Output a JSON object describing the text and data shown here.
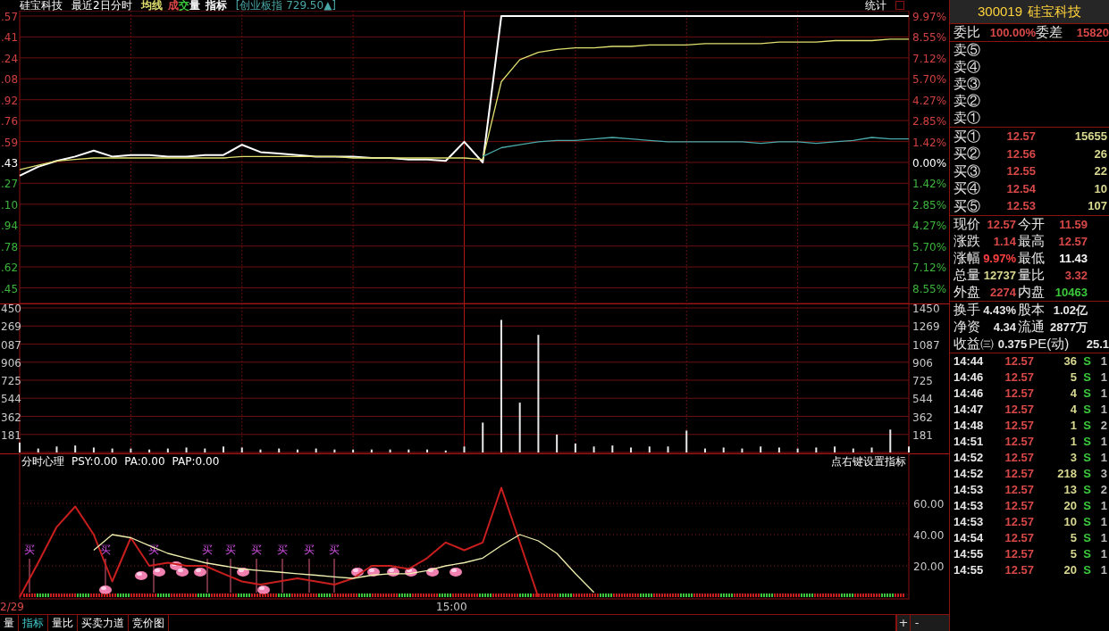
{
  "title_bar": {
    "stock_name": "硅宝科技",
    "period": "最近2日分时",
    "legend": [
      {
        "label": "均线",
        "color": "#e0e070"
      },
      {
        "label": "成",
        "color": "#e04848"
      },
      {
        "label": "交",
        "color": "#3cc83c"
      },
      {
        "label": "量",
        "color": "#ffffff"
      },
      {
        "label": "指标",
        "color": "#ffffff"
      }
    ],
    "index_info": "[创业板指 729.50▲]",
    "stats_button": "统计"
  },
  "price_chart": {
    "left_axis_labels": [
      ".57",
      ".41",
      ".24",
      ".08",
      ".92",
      ".76",
      ".59",
      ".43",
      ".27",
      ".10",
      ".94",
      ".78",
      ".62",
      ".45"
    ],
    "chart_data": {
      "type": "line",
      "categories": [
        null,
        null,
        null,
        null,
        null,
        null,
        null,
        null,
        null,
        null,
        null,
        null,
        null,
        null,
        null,
        null,
        null,
        null,
        null,
        null,
        null,
        null,
        null,
        null,
        null,
        null,
        null,
        null,
        null,
        null,
        null,
        null,
        null,
        null,
        null,
        null,
        null,
        null,
        null,
        null,
        null,
        null,
        null,
        null,
        null,
        null,
        null,
        null,
        null
      ],
      "ylim": [
        -9.61,
        9.97
      ],
      "grid": true,
      "yticks": [
        {
          "value": 9.97,
          "label": "9.97%"
        },
        {
          "value": 8.55,
          "label": "8.55%"
        },
        {
          "value": 7.12,
          "label": "7.12%"
        },
        {
          "value": 5.7,
          "label": "5.70%"
        },
        {
          "value": 4.27,
          "label": "4.27%"
        },
        {
          "value": 2.85,
          "label": "2.85%"
        },
        {
          "value": 1.42,
          "label": "1.42%"
        },
        {
          "value": 0,
          "label": "0.00%"
        },
        {
          "value": -1.42,
          "label": "1.42%"
        },
        {
          "value": -2.85,
          "label": "2.85%"
        },
        {
          "value": -4.27,
          "label": "4.27%"
        },
        {
          "value": -5.7,
          "label": "5.70%"
        },
        {
          "value": -7.12,
          "label": "7.12%"
        },
        {
          "value": -8.55,
          "label": "8.55%"
        }
      ],
      "series": [
        {
          "color": "#ffffff",
          "values": [
            -0.9,
            -0.3,
            0.1,
            0.4,
            0.8,
            0.4,
            0.5,
            0.5,
            0.4,
            0.4,
            0.5,
            0.5,
            1.2,
            0.7,
            0.6,
            0.5,
            0.4,
            0.4,
            0.4,
            0.3,
            0.3,
            0.2,
            0.2,
            0.1,
            1.4,
            0.0,
            9.97,
            9.97,
            9.97,
            9.97,
            9.97,
            9.97,
            9.97,
            9.97,
            9.97,
            9.97,
            9.97,
            9.97,
            9.97,
            9.97,
            9.97,
            9.97,
            9.97,
            9.97,
            9.97,
            9.97,
            9.97,
            9.97,
            9.97
          ]
        },
        {
          "color": "#e0e070",
          "values": [
            -0.5,
            -0.2,
            0.1,
            0.2,
            0.3,
            0.3,
            0.3,
            0.3,
            0.3,
            0.3,
            0.3,
            0.3,
            0.4,
            0.4,
            0.4,
            0.4,
            0.4,
            0.4,
            0.3,
            0.3,
            0.3,
            0.3,
            0.3,
            0.3,
            0.3,
            0.2,
            5.5,
            7.0,
            7.5,
            7.7,
            7.8,
            7.8,
            7.9,
            7.9,
            8.0,
            8.0,
            8.0,
            8.1,
            8.1,
            8.1,
            8.1,
            8.2,
            8.2,
            8.2,
            8.3,
            8.3,
            8.3,
            8.4,
            8.4
          ]
        },
        {
          "color": "#4aa8a8",
          "values": [
            null,
            null,
            null,
            null,
            null,
            null,
            null,
            null,
            null,
            null,
            null,
            null,
            null,
            null,
            null,
            null,
            null,
            null,
            null,
            null,
            null,
            null,
            null,
            null,
            null,
            0.4,
            1.0,
            1.2,
            1.4,
            1.5,
            1.5,
            1.6,
            1.7,
            1.6,
            1.5,
            1.4,
            1.4,
            1.4,
            1.4,
            1.4,
            1.3,
            1.4,
            1.4,
            1.3,
            1.4,
            1.5,
            1.7,
            1.6,
            1.6
          ]
        }
      ]
    }
  },
  "volume_chart": {
    "left_axis_labels": [
      "450",
      "269",
      "087",
      "906",
      "725",
      "544",
      "362",
      "181"
    ],
    "chart_data": {
      "type": "bar",
      "categories": [
        null,
        null,
        null,
        null,
        null,
        null,
        null,
        null,
        null,
        null,
        null,
        null,
        null,
        null,
        null,
        null,
        null,
        null,
        null,
        null,
        null,
        null,
        null,
        null,
        null,
        null,
        null,
        null,
        null,
        null,
        null,
        null,
        null,
        null,
        null,
        null,
        null,
        null,
        null,
        null,
        null,
        null,
        null,
        null,
        null,
        null,
        null,
        null,
        null
      ],
      "ylim": [
        0,
        1495
      ],
      "grid": true,
      "yticks": [
        {
          "value": 1450,
          "label": "1450"
        },
        {
          "value": 1269,
          "label": "1269"
        },
        {
          "value": 1087,
          "label": "1087"
        },
        {
          "value": 906,
          "label": "906"
        },
        {
          "value": 725,
          "label": "725"
        },
        {
          "value": 544,
          "label": "544"
        },
        {
          "value": 362,
          "label": "362"
        },
        {
          "value": 181,
          "label": "181"
        }
      ],
      "series": [
        {
          "color": "#e8e8e8",
          "values": [
            100,
            40,
            60,
            70,
            50,
            40,
            40,
            30,
            40,
            50,
            40,
            60,
            50,
            30,
            40,
            30,
            40,
            30,
            30,
            30,
            30,
            30,
            30,
            20,
            60,
            300,
            1330,
            500,
            1180,
            180,
            90,
            60,
            70,
            50,
            60,
            60,
            220,
            40,
            50,
            40,
            60,
            50,
            40,
            50,
            60,
            40,
            50,
            230,
            60
          ]
        }
      ]
    }
  },
  "indicator": {
    "name": "分时心理",
    "readings": [
      "PSY:0.00",
      "PA:0.00",
      "PAP:0.00"
    ],
    "hint": "点右键设置指标",
    "chart_data": {
      "type": "line",
      "categories": [
        null,
        null,
        null,
        null,
        null,
        null,
        null,
        null,
        null,
        null,
        null,
        null,
        null,
        null,
        null,
        null,
        null,
        null,
        null,
        null,
        null,
        null,
        null,
        null,
        null,
        null,
        null,
        null,
        null,
        null,
        null,
        null,
        null,
        null,
        null,
        null,
        null,
        null,
        null,
        null,
        null,
        null,
        null,
        null,
        null,
        null,
        null,
        null,
        null
      ],
      "ylim": [
        0,
        92
      ],
      "grid": true,
      "yticks": [
        {
          "value": 60,
          "label": "60.00"
        },
        {
          "value": 40,
          "label": "40.00"
        },
        {
          "value": 20,
          "label": "20.00"
        }
      ],
      "series": [
        {
          "color": "#c81e1e",
          "values": [
            0,
            22,
            45,
            58,
            40,
            10,
            38,
            20,
            22,
            20,
            20,
            15,
            10,
            8,
            10,
            12,
            10,
            8,
            12,
            20,
            20,
            18,
            25,
            35,
            30,
            35,
            70,
            35,
            0,
            null,
            null,
            null,
            null,
            null,
            null,
            null,
            null,
            null,
            null,
            null,
            null,
            null,
            null,
            null,
            null,
            null,
            null,
            null,
            null
          ]
        },
        {
          "color": "#f0f0b0",
          "values": [
            null,
            null,
            null,
            null,
            30,
            40,
            38,
            33,
            28,
            25,
            22,
            20,
            18,
            17,
            16,
            15,
            14,
            13,
            12,
            14,
            15,
            15,
            17,
            20,
            22,
            25,
            33,
            40,
            36,
            28,
            15,
            3,
            null,
            null,
            null,
            null,
            null,
            null,
            null,
            null,
            null,
            null,
            null,
            null,
            null,
            null,
            null,
            null,
            null
          ]
        }
      ]
    },
    "buy_marks": [
      "买",
      "买",
      "买",
      "买",
      "买",
      "买",
      "买",
      "买",
      "买"
    ]
  },
  "x_axis": {
    "date_label": "2/29",
    "time_label": "15:00"
  },
  "tabs": [
    {
      "label": "量",
      "selected": false
    },
    {
      "label": "指标",
      "selected": true
    },
    {
      "label": "量比",
      "selected": false
    },
    {
      "label": "买卖力道",
      "selected": false
    },
    {
      "label": "竞价图",
      "selected": false
    }
  ],
  "zoom_buttons": [
    "+",
    "-"
  ],
  "quote_panel": {
    "code": "300019",
    "name": "硅宝科技",
    "order_ratio": [
      {
        "label": "委比",
        "value": "100.00%"
      },
      {
        "label": "委差",
        "value": "15820"
      }
    ],
    "sell_levels": [
      {
        "label": "卖⑤"
      },
      {
        "label": "卖④"
      },
      {
        "label": "卖③"
      },
      {
        "label": "卖②"
      },
      {
        "label": "卖①"
      }
    ],
    "buy_levels": [
      {
        "label": "买①",
        "price": "12.57",
        "volume": "15655"
      },
      {
        "label": "买②",
        "price": "12.56",
        "volume": "26"
      },
      {
        "label": "买③",
        "price": "12.55",
        "volume": "22"
      },
      {
        "label": "买④",
        "price": "12.54",
        "volume": "10"
      },
      {
        "label": "买⑤",
        "price": "12.53",
        "volume": "107"
      }
    ],
    "quote_rows": [
      [
        {
          "label": "现价",
          "value": "12.57",
          "color": "#d84848"
        },
        {
          "label": "今开",
          "value": "11.59",
          "color": "#d84848"
        }
      ],
      [
        {
          "label": "涨跌",
          "value": "1.14",
          "color": "#d84848"
        },
        {
          "label": "最高",
          "value": "12.57",
          "color": "#d84848"
        }
      ],
      [
        {
          "label": "涨幅",
          "value": "9.97%",
          "color": "#ff4040"
        },
        {
          "label": "最低",
          "value": "11.43",
          "color": "#ffffff"
        }
      ],
      [
        {
          "label": "总量",
          "value": "12737",
          "color": "#d8d890"
        },
        {
          "label": "量比",
          "value": "3.32",
          "color": "#d84848"
        }
      ],
      [
        {
          "label": "外盘",
          "value": "2274",
          "color": "#d84848"
        },
        {
          "label": "内盘",
          "value": "10463",
          "color": "#3cc83c"
        }
      ]
    ],
    "stats_rows": [
      [
        {
          "label": "换手",
          "value": "4.43%"
        },
        {
          "label": "股本",
          "value": "1.02亿"
        }
      ],
      [
        {
          "label": "净资",
          "value": "4.34"
        },
        {
          "label": "流通",
          "value": "2877万"
        }
      ],
      [
        {
          "label": "收益㈢",
          "value": "0.375"
        },
        {
          "label": "PE(动)",
          "value": "25.1"
        }
      ]
    ],
    "trades": [
      {
        "time": "14:44",
        "price": "12.57",
        "volume": "36",
        "side": "S",
        "column_5": "1"
      },
      {
        "time": "14:46",
        "price": "12.57",
        "volume": "5",
        "side": "S",
        "column_5": "1"
      },
      {
        "time": "14:46",
        "price": "12.57",
        "volume": "4",
        "side": "S",
        "column_5": "1"
      },
      {
        "time": "14:47",
        "price": "12.57",
        "volume": "4",
        "side": "S",
        "column_5": "1"
      },
      {
        "time": "14:48",
        "price": "12.57",
        "volume": "1",
        "side": "S",
        "column_5": "2"
      },
      {
        "time": "14:51",
        "price": "12.57",
        "volume": "1",
        "side": "S",
        "column_5": "1"
      },
      {
        "time": "14:52",
        "price": "12.57",
        "volume": "3",
        "side": "S",
        "column_5": "1"
      },
      {
        "time": "14:52",
        "price": "12.57",
        "volume": "218",
        "side": "S",
        "column_5": "3"
      },
      {
        "time": "14:53",
        "price": "12.57",
        "volume": "13",
        "side": "S",
        "column_5": "2"
      },
      {
        "time": "14:53",
        "price": "12.57",
        "volume": "20",
        "side": "S",
        "column_5": "1"
      },
      {
        "time": "14:53",
        "price": "12.57",
        "volume": "10",
        "side": "S",
        "column_5": "1"
      },
      {
        "time": "14:54",
        "price": "12.57",
        "volume": "5",
        "side": "S",
        "column_5": "1"
      },
      {
        "time": "14:55",
        "price": "12.57",
        "volume": "5",
        "side": "S",
        "column_5": "1"
      },
      {
        "time": "14:55",
        "price": "12.57",
        "volume": "20",
        "side": "S",
        "column_5": "1"
      }
    ]
  }
}
